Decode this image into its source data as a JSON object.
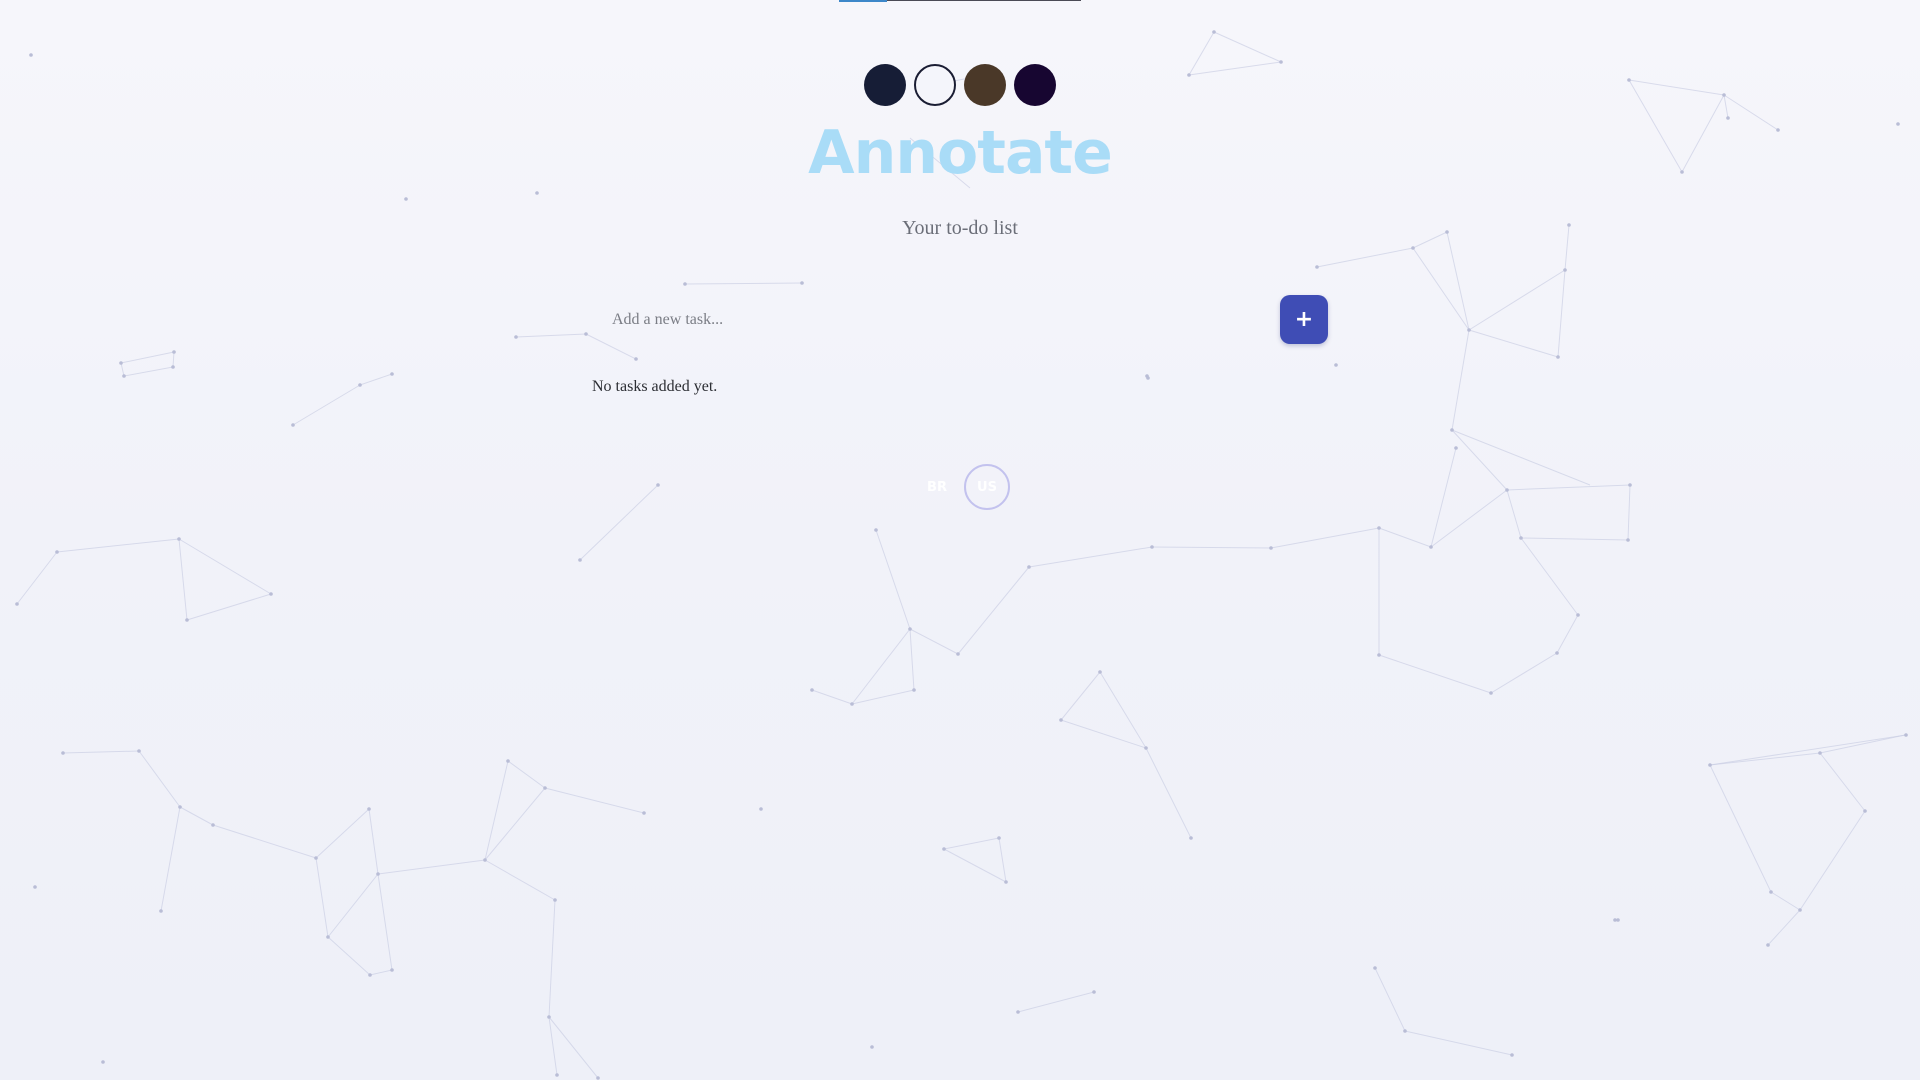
{
  "app": {
    "title": "Annotate",
    "subtitle": "Your to-do list"
  },
  "progress": {
    "value": 0.2
  },
  "themes": [
    {
      "name": "dark-navy",
      "color": "#161d36",
      "active": false
    },
    {
      "name": "light",
      "color": "#f4f5fb",
      "active": true
    },
    {
      "name": "brown",
      "color": "#4a3828",
      "active": false
    },
    {
      "name": "dark-purple",
      "color": "#170631",
      "active": false
    }
  ],
  "task_input": {
    "placeholder": "Add a new task...",
    "value": ""
  },
  "add_button": {
    "label": "+",
    "color": "#3f4db5"
  },
  "tasks": {
    "empty_message": "No tasks added yet.",
    "items": []
  },
  "languages": [
    {
      "label": "BR",
      "selected": false
    },
    {
      "label": "US",
      "selected": true
    }
  ],
  "colors": {
    "title": "#a9dcf7",
    "accent": "#3f4db5"
  }
}
